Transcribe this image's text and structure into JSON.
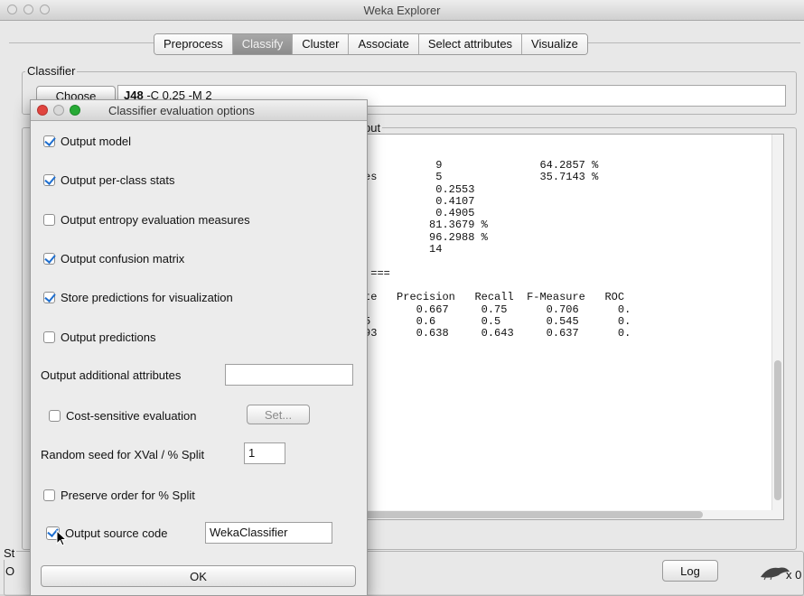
{
  "window": {
    "title": "Weka Explorer"
  },
  "tabs": [
    "Preprocess",
    "Classify",
    "Cluster",
    "Associate",
    "Select attributes",
    "Visualize"
  ],
  "classifier": {
    "group_label": "Classifier",
    "choose_label": "Choose",
    "name": "J48",
    "options": "-C 0.25 -M 2"
  },
  "output": {
    "group_label_fragment": "put",
    "lines": [
      "Correctly Classified Instances           9               64.2857 %",
      "Incorrectly Classified Instances         5               35.7143 %",
      "Kappa statistic                          0.2553",
      "Mean absolute error                      0.4107",
      "Root mean squared error                  0.4905",
      "Relative absolute error                 81.3679 %",
      "Root relative squared error             96.2988 %",
      "Total Number of Instances               14",
      "",
      "=== Detailed Accuracy By Class ===",
      "",
      "               TP Rate   FP Rate   Precision   Recall  F-Measure   ROC",
      "                 0.75      0.5        0.667     0.75      0.706      0.",
      "                 0.5       0.25       0.6       0.5       0.545      0.",
      "Weighted Avg.    0.643     0.393      0.638     0.643     0.637      0.",
      "",
      "=== Confusion Matrix ===",
      "",
      " a b   <-- classified as",
      " 6 2 | a = yes",
      " 3 3 | b = no"
    ]
  },
  "status": {
    "label_fragment": "St",
    "text_fragment": "O",
    "log_label": "Log",
    "count": "x 0"
  },
  "dialog": {
    "title": "Classifier evaluation options",
    "options": [
      {
        "label": "Output model",
        "checked": true
      },
      {
        "label": "Output per-class stats",
        "checked": true
      },
      {
        "label": "Output entropy evaluation measures",
        "checked": false
      },
      {
        "label": "Output confusion matrix",
        "checked": true
      },
      {
        "label": "Store predictions for visualization",
        "checked": true
      },
      {
        "label": "Output predictions",
        "checked": false
      }
    ],
    "additional_attributes_label": "Output additional attributes",
    "additional_attributes_value": "",
    "cost_sensitive_label": "Cost-sensitive evaluation",
    "cost_sensitive_checked": false,
    "set_label": "Set...",
    "random_seed_label": "Random seed for XVal / % Split",
    "random_seed_value": "1",
    "preserve_order_label": "Preserve order for % Split",
    "preserve_order_checked": false,
    "source_code_label": "Output source code",
    "source_code_checked": true,
    "source_code_value": "WekaClassifier",
    "ok_label": "OK"
  },
  "colors": {
    "active_tab": "#9a9a9a",
    "checkmark": "#1f6fcf",
    "close_red": "#e0443e",
    "minimize_yellow": "#dea123",
    "zoom_green": "#27aa35"
  }
}
